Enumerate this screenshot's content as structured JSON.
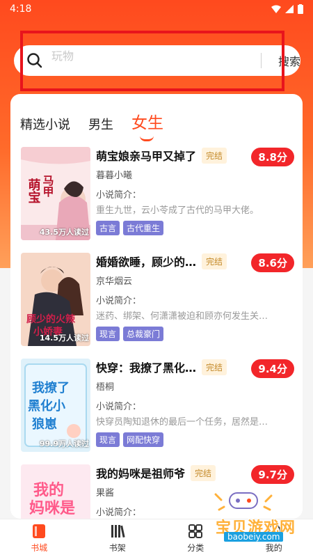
{
  "status_bar": {
    "time": "4:18"
  },
  "search": {
    "placeholder": "玩物",
    "button": "搜索"
  },
  "tabs": [
    {
      "label": "精选小说"
    },
    {
      "label": "男生"
    },
    {
      "label": "女生"
    }
  ],
  "books": [
    {
      "title": "萌宝娘亲马甲又掉了",
      "status": "完结",
      "score": "8.8分",
      "author": "暮暮小曦",
      "intro_label": "小说简介：",
      "intro": "重生九世，云小苓成了古代的马甲大佬。",
      "tags": [
        "古言",
        "古代重生"
      ],
      "reads": "43.5万人读过",
      "cover_text": "名甲又掉了 萌宝娘亲"
    },
    {
      "title": "婚婚欲睡，顾少的…",
      "status": "完结",
      "score": "8.6分",
      "author": "京华烟云",
      "intro_label": "小说简介：",
      "intro": "迷药、绑架、何潇潇被迫和顾亦何发生关…",
      "tags": [
        "现言",
        "总裁豪门"
      ],
      "reads": "14.5万人读过",
      "cover_text": "顾少的火辣小娇妻"
    },
    {
      "title": "快穿：我撩了黑化…",
      "status": "完结",
      "score": "9.4分",
      "author": "梧桐",
      "intro_label": "小说简介：",
      "intro": "快穿员陶知退休的最后一个任务，居然是…",
      "tags": [
        "现言",
        "网配快穿"
      ],
      "reads": "99.9万人读过",
      "cover_text": "我撩了黑化小狼崽"
    },
    {
      "title": "我的妈咪是祖师爷",
      "status": "完结",
      "score": "9.7分",
      "author": "果酱",
      "intro_label": "小说简介：",
      "intro": "",
      "tags": [],
      "reads": "",
      "cover_text": "我的妈咪是"
    }
  ],
  "tabbar": [
    {
      "label": "书城",
      "icon": "book-icon"
    },
    {
      "label": "书架",
      "icon": "shelf-icon"
    },
    {
      "label": "分类",
      "icon": "category-icon"
    },
    {
      "label": "我的",
      "icon": "profile-icon"
    }
  ],
  "watermark": {
    "text": "宝贝游戏网",
    "url": "baobeiy.com"
  },
  "colors": {
    "accent": "#ff4a1e",
    "score_badge": "#f2262a",
    "tag": "#7b7bd6",
    "annotation": "#e8141c"
  }
}
